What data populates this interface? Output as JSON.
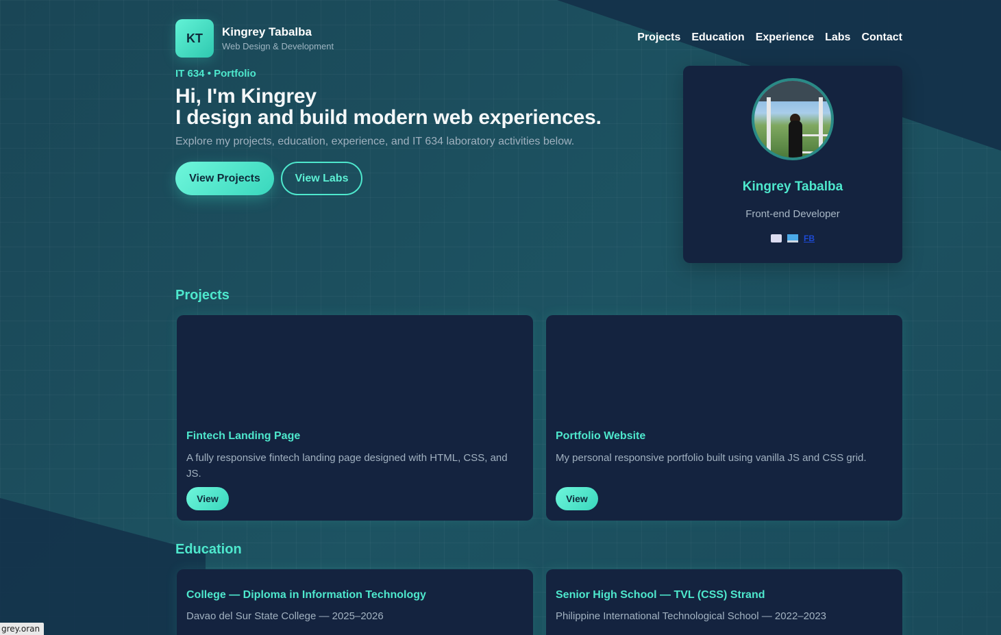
{
  "brand": {
    "initials": "KT",
    "name": "Kingrey Tabalba",
    "subtitle": "Web Design & Development"
  },
  "nav": [
    "Projects",
    "Education",
    "Experience",
    "Labs",
    "Contact"
  ],
  "hero": {
    "eyebrow": "IT 634 • Portfolio",
    "title_line1": "Hi, I'm Kingrey",
    "title_line2": "I design and build modern web experiences.",
    "description": "Explore my projects, education, experience, and IT 634 laboratory activities below.",
    "primary_button": "View Projects",
    "secondary_button": "View Labs"
  },
  "profile": {
    "name": "Kingrey Tabalba",
    "role": "Front-end Developer",
    "links": [
      "mail-icon",
      "laptop-icon"
    ],
    "fb_label": "FB"
  },
  "projects": {
    "title": "Projects",
    "items": [
      {
        "title": "Fintech Landing Page",
        "description": "A fully responsive fintech landing page designed with HTML, CSS, and JS.",
        "button": "View"
      },
      {
        "title": "Portfolio Website",
        "description": "My personal responsive portfolio built using vanilla JS and CSS grid.",
        "button": "View"
      }
    ]
  },
  "education": {
    "title": "Education",
    "items": [
      {
        "title": "College — Diploma in Information Technology",
        "detail": "Davao del Sur State College — 2025–2026"
      },
      {
        "title": "Senior High School — TVL (CSS) Strand",
        "detail": "Philippine International Technological School — 2022–2023"
      }
    ]
  },
  "status_bar": "grey.oran",
  "colors": {
    "accent": "#4ee8cd",
    "card": "#14233f",
    "background": "#1a4a5a"
  }
}
